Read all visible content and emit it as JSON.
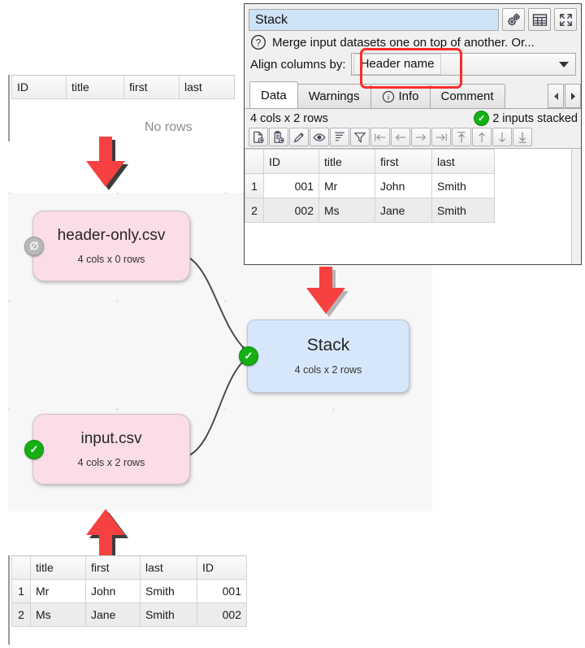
{
  "top_preview": {
    "columns": [
      "ID",
      "title",
      "first",
      "last"
    ],
    "empty_message": "No rows"
  },
  "bottom_preview": {
    "columns": [
      "title",
      "first",
      "last",
      "ID"
    ],
    "rows": [
      {
        "n": "1",
        "title": "Mr",
        "first": "John",
        "last": "Smith",
        "id": "001"
      },
      {
        "n": "2",
        "title": "Ms",
        "first": "Jane",
        "last": "Smith",
        "id": "002"
      }
    ]
  },
  "canvas": {
    "nodes": [
      {
        "title": "header-only.csv",
        "subtitle": "4 cols x 0 rows",
        "badge": "none",
        "color": "#fadde5"
      },
      {
        "title": "input.csv",
        "subtitle": "4 cols x 2 rows",
        "badge": "ok",
        "color": "#fadde5"
      },
      {
        "title": "Stack",
        "subtitle": "4 cols x 2 rows",
        "badge": "ok",
        "color": "#d7e7fb"
      }
    ]
  },
  "panel": {
    "title": "Stack",
    "title_buttons": [
      "gears-icon",
      "table-icon",
      "expand-icon"
    ],
    "description": "Merge input datasets one on top of another. Or...",
    "align_label": "Align columns by:",
    "align_value": "Header name",
    "tabs": [
      {
        "label": "Data",
        "active": true
      },
      {
        "label": "Warnings",
        "active": false
      },
      {
        "label": "Info",
        "active": false,
        "icon": "info-icon"
      },
      {
        "label": "Comment",
        "active": false
      }
    ],
    "status_left": "4 cols x 2 rows",
    "status_right": "2 inputs stacked",
    "toolbar_icons": [
      "new-file-icon",
      "paste-icon",
      "edit-icon",
      "view-icon",
      "sort-icon",
      "filter-icon",
      "first-column-icon",
      "previous-column-icon",
      "next-column-icon",
      "last-column-icon",
      "first-row-icon",
      "previous-row-icon",
      "next-row-icon",
      "last-row-icon"
    ],
    "grid": {
      "columns": [
        "ID",
        "title",
        "first",
        "last"
      ],
      "rows": [
        {
          "n": "1",
          "id": "001",
          "title": "Mr",
          "first": "John",
          "last": "Smith"
        },
        {
          "n": "2",
          "id": "002",
          "title": "Ms",
          "first": "Jane",
          "last": "Smith"
        }
      ]
    }
  },
  "colors": {
    "accent_red": "#fb2b2b",
    "ok_green": "#14b014",
    "node_pink": "#fadde5",
    "node_blue": "#d7e7fb",
    "title_field": "#cfe3f7"
  }
}
